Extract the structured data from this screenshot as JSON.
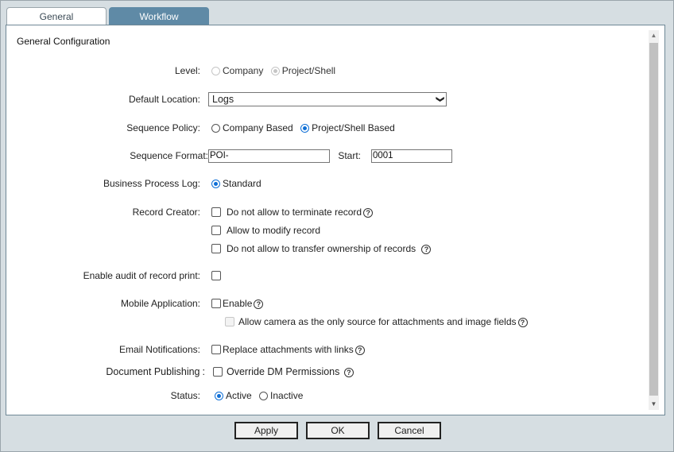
{
  "tabs": [
    {
      "label": "General",
      "active": true
    },
    {
      "label": "Workflow",
      "active": false
    }
  ],
  "panel": {
    "title": "General Configuration"
  },
  "form": {
    "level": {
      "label": "Level:",
      "options": [
        "Company",
        "Project/Shell"
      ],
      "selected": "Project/Shell",
      "disabled": true
    },
    "default_location": {
      "label": "Default Location:",
      "value": "Logs"
    },
    "sequence_policy": {
      "label": "Sequence Policy:",
      "options": [
        "Company Based",
        "Project/Shell Based"
      ],
      "selected": "Project/Shell Based"
    },
    "sequence_format": {
      "label": "Sequence Format:",
      "value": "POI-",
      "start_label": "Start:",
      "start_value": "0001"
    },
    "business_process_log": {
      "label": "Business Process Log:",
      "option": "Standard",
      "selected": true
    },
    "record_creator": {
      "label": "Record Creator:",
      "options": [
        {
          "text": "Do not allow to terminate record",
          "checked": false,
          "help": true
        },
        {
          "text": "Allow to modify record",
          "checked": false,
          "help": false
        },
        {
          "text": "Do not allow to transfer ownership of records",
          "checked": false,
          "help": true
        }
      ]
    },
    "audit_print": {
      "label": "Enable audit of record print:",
      "checked": false
    },
    "mobile_application": {
      "label": "Mobile Application:",
      "enable_text": "Enable",
      "enable_checked": false,
      "camera_text": "Allow camera as the only source for attachments and image fields",
      "camera_checked": false,
      "camera_disabled": true
    },
    "email_notifications": {
      "label": "Email Notifications:",
      "text": "Replace attachments with links",
      "checked": false
    },
    "document_publishing": {
      "label": "Document Publishing",
      "separator": ":",
      "text": "Override DM Permissions",
      "checked": false
    },
    "status": {
      "label": "Status:",
      "options": [
        "Active",
        "Inactive"
      ],
      "selected": "Active"
    }
  },
  "help_glyph": "?",
  "icons": {
    "chevron_down": "❯",
    "scroll_up": "▲",
    "scroll_down": "▼"
  },
  "buttons": {
    "apply": "Apply",
    "ok": "OK",
    "cancel": "Cancel"
  },
  "colors": {
    "accent": "#0f6fd6",
    "tab_inactive": "#5f8aa6",
    "background": "#d6dee2"
  }
}
